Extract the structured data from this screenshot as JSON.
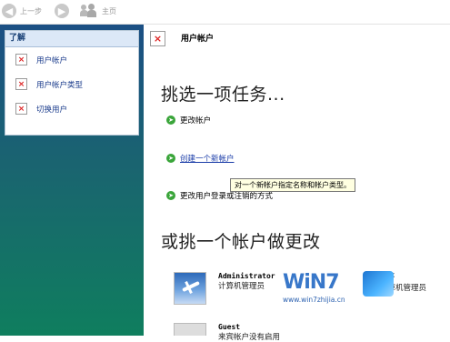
{
  "toolbar": {
    "back_label": "上一步",
    "home_label": "主页"
  },
  "sidebar": {
    "header": "了解",
    "items": [
      {
        "label": "用户帐户"
      },
      {
        "label": "用户帐户类型"
      },
      {
        "label": "切换用户"
      }
    ]
  },
  "main": {
    "title": "用户帐户",
    "task_heading": "挑选一项任务...",
    "tasks": [
      {
        "label": "更改帐户"
      },
      {
        "label": "创建一个新帐户"
      },
      {
        "label": "更改用户登录或注销的方式"
      }
    ],
    "tooltip": "对一个新帐户指定名称和帐户类型。",
    "account_heading": "或挑一个帐户做更改",
    "accounts": [
      {
        "name": "Administrator",
        "role": "计算机管理员"
      },
      {
        "name": "凡哥",
        "role": "计算机管理员"
      },
      {
        "name": "Guest",
        "role": "来宾帐户没有启用"
      }
    ]
  },
  "watermark": {
    "logo": "WiN7",
    "url": "www.win7zhijia.cn"
  }
}
